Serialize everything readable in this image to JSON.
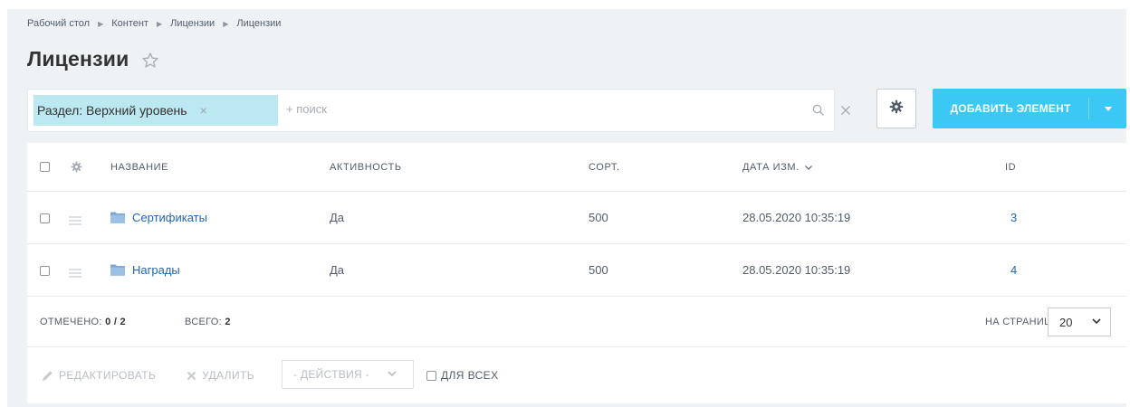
{
  "breadcrumb": [
    "Рабочий стол",
    "Контент",
    "Лицензии",
    "Лицензии"
  ],
  "page_title": "Лицензии",
  "filter": {
    "tag_label": "Раздел: Верхний уровень",
    "search_placeholder": "+ поиск"
  },
  "toolbar": {
    "add_button_label": "ДОБАВИТЬ ЭЛЕМЕНТ"
  },
  "grid": {
    "columns": [
      "НАЗВАНИЕ",
      "АКТИВНОСТЬ",
      "СОРТ.",
      "ДАТА ИЗМ.",
      "ID"
    ],
    "rows": [
      {
        "name": "Сертификаты",
        "active": "Да",
        "sort": "500",
        "date": "28.05.2020 10:35:19",
        "id": "3"
      },
      {
        "name": "Награды",
        "active": "Да",
        "sort": "500",
        "date": "28.05.2020 10:35:19",
        "id": "4"
      }
    ]
  },
  "footer": {
    "selected_label": "ОТМЕЧЕНО:",
    "selected_value": "0 / 2",
    "total_label": "ВСЕГО:",
    "total_value": "2",
    "per_page_label": "НА СТРАНИЦЕ:",
    "per_page_value": "20"
  },
  "actions": {
    "edit_label": "РЕДАКТИРОВАТЬ",
    "delete_label": "УДАЛИТЬ",
    "actions_select": "- ДЕЙСТВИЯ -",
    "for_all_label": "ДЛЯ ВСЕХ"
  },
  "colors": {
    "accent": "#3bc8f5",
    "tag_bg": "#bce8f1",
    "link": "#2067b0",
    "page_bg": "#eef2f4"
  },
  "icons": [
    "star-icon",
    "search-icon",
    "clear-icon",
    "gear-icon",
    "chevron-down-icon",
    "drag-handle-icon",
    "folder-icon",
    "pencil-icon",
    "cross-icon"
  ]
}
